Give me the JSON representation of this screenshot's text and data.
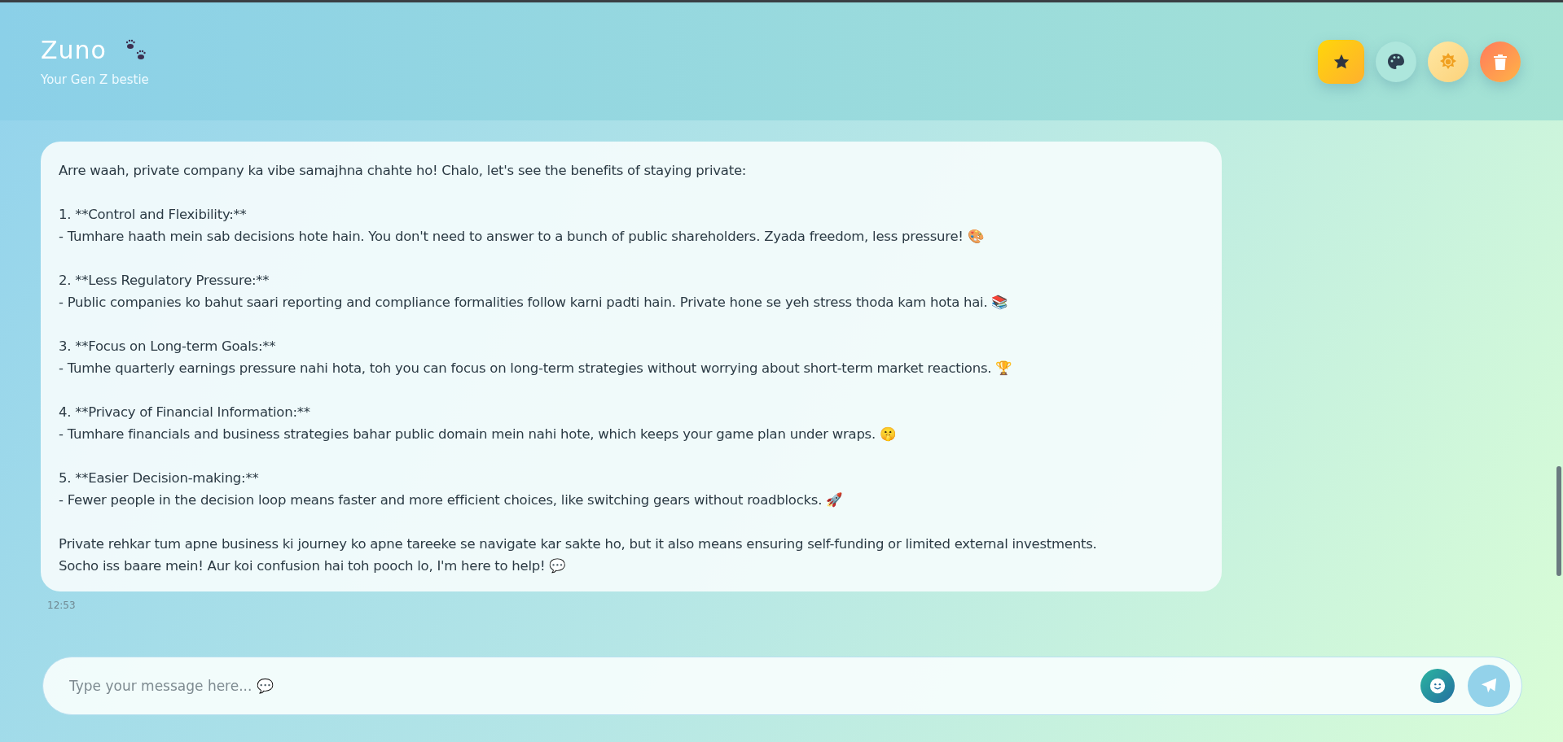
{
  "header": {
    "title": "Zuno",
    "subtitle": "Your Gen Z bestie",
    "actions": [
      {
        "kind": "star"
      },
      {
        "kind": "palette"
      },
      {
        "kind": "sun"
      },
      {
        "kind": "trash"
      }
    ]
  },
  "messages": [
    {
      "text": "Arre waah, private company ka vibe samajhna chahte ho! Chalo, let's see the benefits of staying private:\n\n1. **Control and Flexibility:**\n- Tumhare haath mein sab decisions hote hain. You don't need to answer to a bunch of public shareholders. Zyada freedom, less pressure! 🎨\n\n2. **Less Regulatory Pressure:**\n- Public companies ko bahut saari reporting and compliance formalities follow karni padti hain. Private hone se yeh stress thoda kam hota hai. 📚\n\n3. **Focus on Long-term Goals:**\n- Tumhe quarterly earnings pressure nahi hota, toh you can focus on long-term strategies without worrying about short-term market reactions. 🏆\n\n4. **Privacy of Financial Information:**\n- Tumhare financials and business strategies bahar public domain mein nahi hote, which keeps your game plan under wraps. 🤫\n\n5. **Easier Decision-making:**\n- Fewer people in the decision loop means faster and more efficient choices, like switching gears without roadblocks. 🚀\n\nPrivate rehkar tum apne business ki journey ko apne tareeke se navigate kar sakte ho, but it also means ensuring self-funding or limited external investments.\nSocho iss baare mein! Aur koi confusion hai toh pooch lo, I'm here to help! 💬",
      "time": "12:53"
    }
  ],
  "composer": {
    "placeholder": "Type your message here... 💬"
  }
}
